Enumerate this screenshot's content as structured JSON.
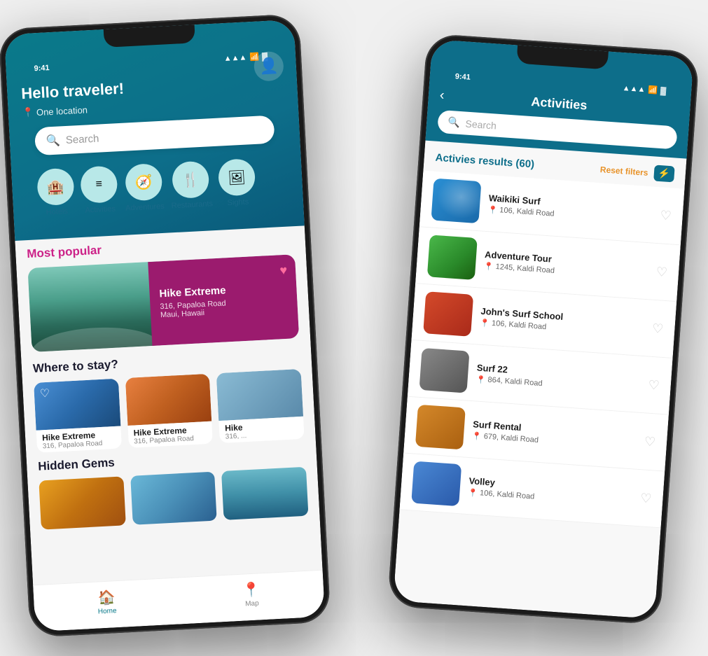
{
  "phones": {
    "left": {
      "status_time": "9:41",
      "header": {
        "greeting": "Hello traveler!",
        "location": "One location"
      },
      "search_placeholder": "Search",
      "categories": [
        {
          "id": "hotels",
          "icon": "🏨",
          "label": "Hotels"
        },
        {
          "id": "activities",
          "icon": "☰",
          "label": "Activities"
        },
        {
          "id": "adventures",
          "icon": "🧭",
          "label": "Adventures"
        },
        {
          "id": "restaurants",
          "icon": "🍴",
          "label": "Restaurants"
        },
        {
          "id": "sights",
          "icon": "🖼",
          "label": "Sights"
        }
      ],
      "most_popular_label": "Most popular",
      "popular_card": {
        "title": "Hike Extreme",
        "address": "316, Papaloa Road",
        "location": "Maui, Hawaii"
      },
      "where_to_stay_label": "Where to stay?",
      "where_cards": [
        {
          "title": "Hike Extreme",
          "address": "316, Papaloa Road"
        },
        {
          "title": "Hike Extreme",
          "address": "316, Papaloa Road"
        },
        {
          "title": "Hike",
          "address": "316, ..."
        }
      ],
      "hidden_gems_label": "Hidden Gems",
      "nav": [
        {
          "label": "Home",
          "icon": "🏠",
          "active": true
        },
        {
          "label": "Map",
          "icon": "📍",
          "active": false
        }
      ]
    },
    "right": {
      "status_time": "9:41",
      "back_label": "‹",
      "title": "Activities",
      "search_placeholder": "Search",
      "results_title": "Activies results (60)",
      "reset_filters_label": "Reset filters",
      "activities": [
        {
          "name": "Waikiki Surf",
          "address": "106, Kaldi Road",
          "thumb_class": "thumb-surf"
        },
        {
          "name": "Adventure Tour",
          "address": "1245, Kaldi Road",
          "thumb_class": "thumb-palm"
        },
        {
          "name": "John's Surf School",
          "address": "106, Kaldi Road",
          "thumb_class": "thumb-van"
        },
        {
          "name": "Surf 22",
          "address": "864, Kaldi Road",
          "thumb_class": "thumb-jet"
        },
        {
          "name": "Surf Rental",
          "address": "679, Kaldi Road",
          "thumb_class": "thumb-rental"
        },
        {
          "name": "Volley",
          "address": "106, Kaldi Road",
          "thumb_class": "thumb-volley"
        }
      ],
      "heart_icon": "♡",
      "pin_icon": "📍",
      "filter_icon": "⚡"
    }
  }
}
